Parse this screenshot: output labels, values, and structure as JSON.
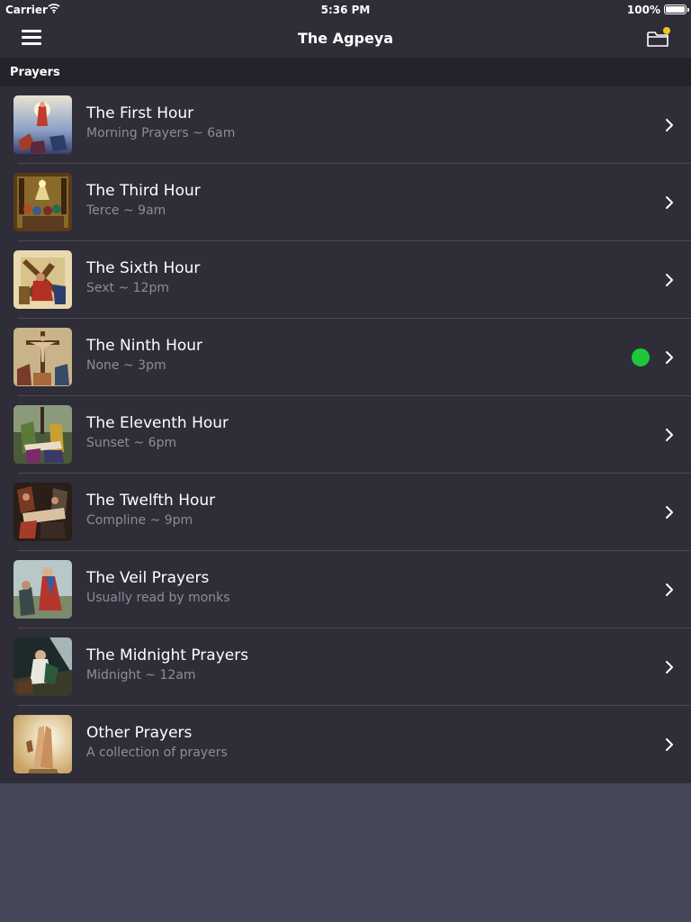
{
  "status_bar": {
    "carrier": "Carrier",
    "time": "5:36 PM",
    "battery": "100%"
  },
  "nav": {
    "title": "The Agpeya",
    "left_icon": "hamburger-menu-icon",
    "right_icon": "folder-icon",
    "badge_color": "#f5c518"
  },
  "section": {
    "title": "Prayers"
  },
  "prayers": [
    {
      "title": "The First Hour",
      "subtitle": "Morning Prayers ~ 6am",
      "icon": "resurrection-icon",
      "current": false
    },
    {
      "title": "The Third Hour",
      "subtitle": "Terce ~ 9am",
      "icon": "pentecost-icon",
      "current": false
    },
    {
      "title": "The Sixth Hour",
      "subtitle": "Sext ~ 12pm",
      "icon": "cross-bearing-icon",
      "current": false
    },
    {
      "title": "The Ninth Hour",
      "subtitle": "None ~ 3pm",
      "icon": "crucifixion-icon",
      "current": true
    },
    {
      "title": "The Eleventh Hour",
      "subtitle": "Sunset ~ 6pm",
      "icon": "deposition-icon",
      "current": false
    },
    {
      "title": "The Twelfth Hour",
      "subtitle": "Compline ~ 9pm",
      "icon": "burial-icon",
      "current": false
    },
    {
      "title": "The Veil Prayers",
      "subtitle": "Usually read by monks",
      "icon": "monk-prayer-icon",
      "current": false
    },
    {
      "title": "The Midnight Prayers",
      "subtitle": "Midnight ~ 12am",
      "icon": "gethsemane-icon",
      "current": false
    },
    {
      "title": "Other Prayers",
      "subtitle": "A collection of prayers",
      "icon": "praying-hands-icon",
      "current": false
    }
  ],
  "colors": {
    "background": "#464659",
    "bar": "#2e2d38",
    "section_header": "#24232c",
    "current_indicator": "#1fc73a"
  }
}
